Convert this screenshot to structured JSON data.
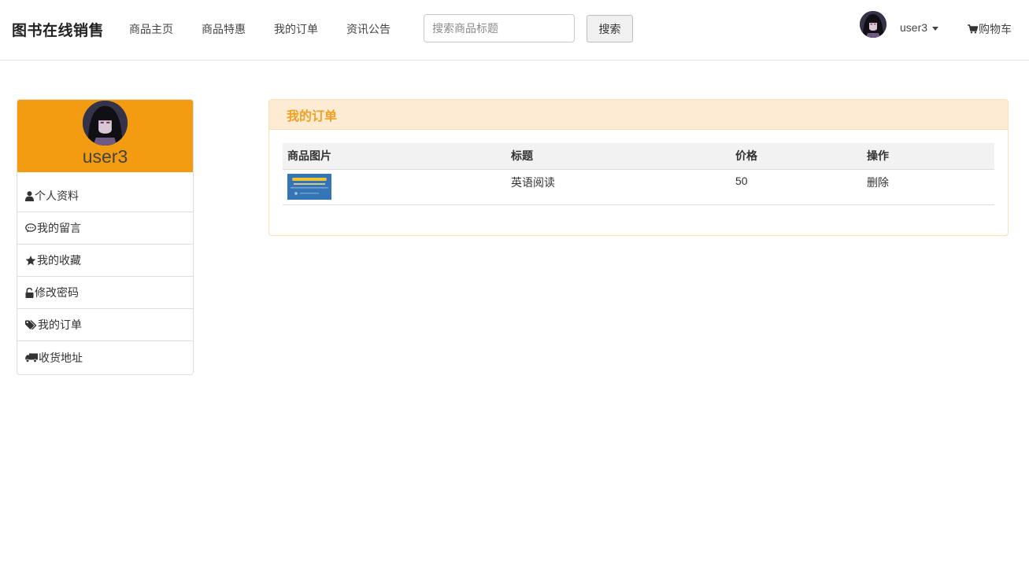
{
  "nav": {
    "brand": "图书在线销售",
    "links": [
      "商品主页",
      "商品特惠",
      "我的订单",
      "资讯公告"
    ],
    "search_placeholder": "搜索商品标题",
    "search_button": "搜索",
    "username": "user3",
    "cart": "购物车"
  },
  "sidebar": {
    "username": "user3",
    "items": [
      "个人资料",
      "我的留言",
      "我的收藏",
      "修改密码",
      "我的订单",
      "收货地址"
    ]
  },
  "orders": {
    "title": "我的订单",
    "columns": [
      "商品图片",
      "标题",
      "价格",
      "操作"
    ],
    "rows": [
      {
        "title": "英语阅读",
        "price": "50",
        "action": "删除"
      }
    ]
  },
  "colors": {
    "accent": "#f39c12",
    "panel_header_bg": "#fdecd3",
    "panel_title": "#f0a022"
  }
}
